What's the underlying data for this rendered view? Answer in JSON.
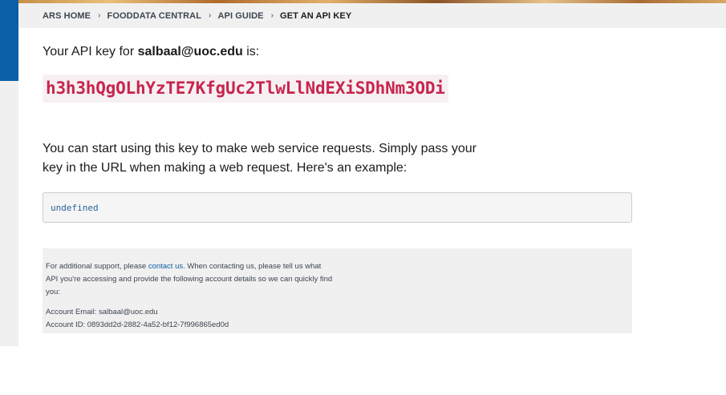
{
  "breadcrumb": {
    "items": [
      {
        "label": "ARS HOME"
      },
      {
        "label": "FOODDATA CENTRAL"
      },
      {
        "label": "API GUIDE"
      }
    ],
    "current": "GET AN API KEY",
    "separator": "›"
  },
  "key_section": {
    "intro_prefix": "Your API key for ",
    "email": "salbaal@uoc.edu",
    "intro_suffix": " is:",
    "api_key": "h3h3hQgOLhYzTE7KfgUc2TlwLlNdEXiSDhNm3ODi"
  },
  "usage": {
    "text": "You can start using this key to make web service requests. Simply pass your key in the URL when making a web request. Here's an example:",
    "example": "undefined"
  },
  "support": {
    "text_before_link": "For additional support, please ",
    "link_label": "contact us",
    "text_after_link": ". When contacting us, please tell us what API you're accessing and provide the following account details so we can quickly find you:",
    "account_email_line": "Account Email: salbaal@uoc.edu",
    "account_id_line": "Account ID: 0893dd2d-2882-4a52-bf12-7f996865ed0d"
  },
  "colors": {
    "accent_blue": "#0b5fa6",
    "key_text": "#c7254e",
    "key_background": "#f7f0f2"
  }
}
